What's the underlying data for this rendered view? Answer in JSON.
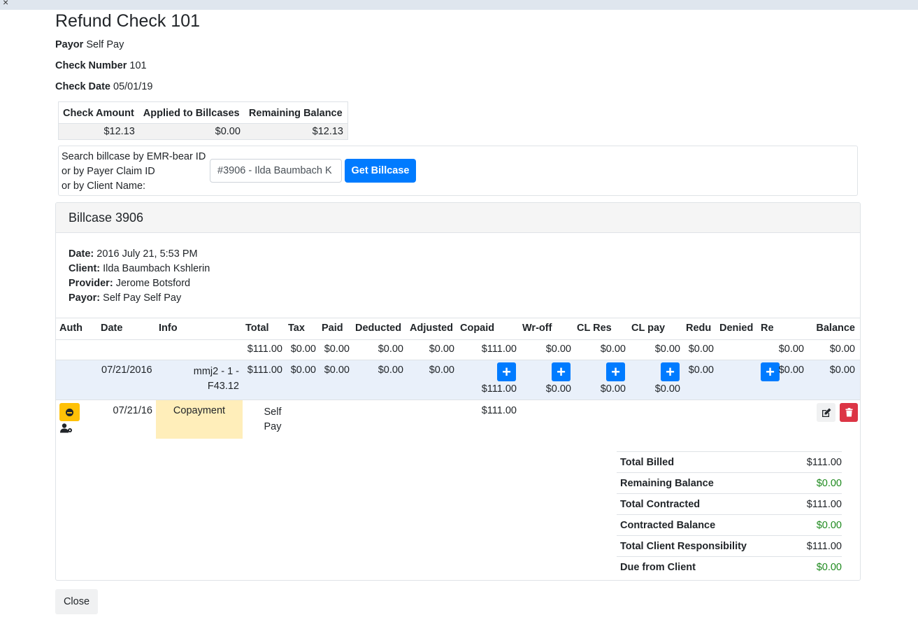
{
  "window": {
    "close_glyph": "×"
  },
  "header": {
    "title": "Refund Check 101"
  },
  "check_info": {
    "payor_label": "Payor",
    "payor_value": "Self Pay",
    "check_number_label": "Check Number",
    "check_number_value": "101",
    "check_date_label": "Check Date",
    "check_date_value": "05/01/19"
  },
  "summary": {
    "headers": [
      "Check Amount",
      "Applied to Billcases",
      "Remaining Balance"
    ],
    "values": [
      "$12.13",
      "$0.00",
      "$12.13"
    ]
  },
  "search": {
    "label_lines": [
      "Search billcase by EMR-bear ID",
      "or by Payer Claim ID",
      "or by Client Name:"
    ],
    "input_value": "#3906 - Ilda Baumbach K",
    "button_label": "Get Billcase"
  },
  "billcase": {
    "title": "Billcase 3906",
    "details": [
      {
        "label": "Date:",
        "value": "2016 July 21, 5:53 PM"
      },
      {
        "label": "Client:",
        "value": "Ilda Baumbach Kshlerin"
      },
      {
        "label": "Provider:",
        "value": "Jerome Botsford"
      },
      {
        "label": "Payor:",
        "value": "Self Pay Self Pay"
      }
    ],
    "columns": [
      "Auth",
      "Date",
      "Info",
      "Total",
      "Tax",
      "Paid",
      "Deducted",
      "Adjusted",
      "Copaid",
      "Wr-off",
      "CL Res",
      "CL pay",
      "Redu",
      "Denied",
      "Re",
      "Balance"
    ],
    "totals_row": {
      "total": "$111.00",
      "tax": "$0.00",
      "paid": "$0.00",
      "deducted": "$0.00",
      "adjusted": "$0.00",
      "copaid": "$111.00",
      "wroff": "$0.00",
      "clres": "$0.00",
      "clpay": "$0.00",
      "redu": "$0.00",
      "re": "$0.00",
      "balance": "$0.00"
    },
    "line_item": {
      "date": "07/21/2016",
      "info_line1": "mmj2 - 1 -",
      "info_line2": "F43.12",
      "total": "$111.00",
      "tax": "$0.00",
      "paid": "$0.00",
      "deducted": "$0.00",
      "adjusted": "$0.00",
      "copaid": "$111.00",
      "wroff": "$0.00",
      "clres": "$0.00",
      "clpay": "$0.00",
      "redu": "$0.00",
      "re": "$0.00",
      "balance": "$0.00",
      "plus_glyph": "+"
    },
    "payment": {
      "date": "07/21/16",
      "type": "Copayment",
      "payer_line1": "Self",
      "payer_line2": "Pay",
      "amount": "$111.00"
    },
    "totals": [
      {
        "label": "Total Billed",
        "value": "$111.00",
        "green": false
      },
      {
        "label": "Remaining Balance",
        "value": "$0.00",
        "green": true
      },
      {
        "label": "Total Contracted",
        "value": "$111.00",
        "green": false
      },
      {
        "label": "Contracted Balance",
        "value": "$0.00",
        "green": true
      },
      {
        "label": "Total Client Responsibility",
        "value": "$111.00",
        "green": false
      },
      {
        "label": "Due from Client",
        "value": "$0.00",
        "green": true
      }
    ]
  },
  "footer": {
    "close_label": "Close"
  },
  "colors": {
    "primary": "#007bff",
    "warning": "#ffc107",
    "danger": "#dc3545",
    "success": "#1e8a1e",
    "highlight": "#ffeeba"
  }
}
